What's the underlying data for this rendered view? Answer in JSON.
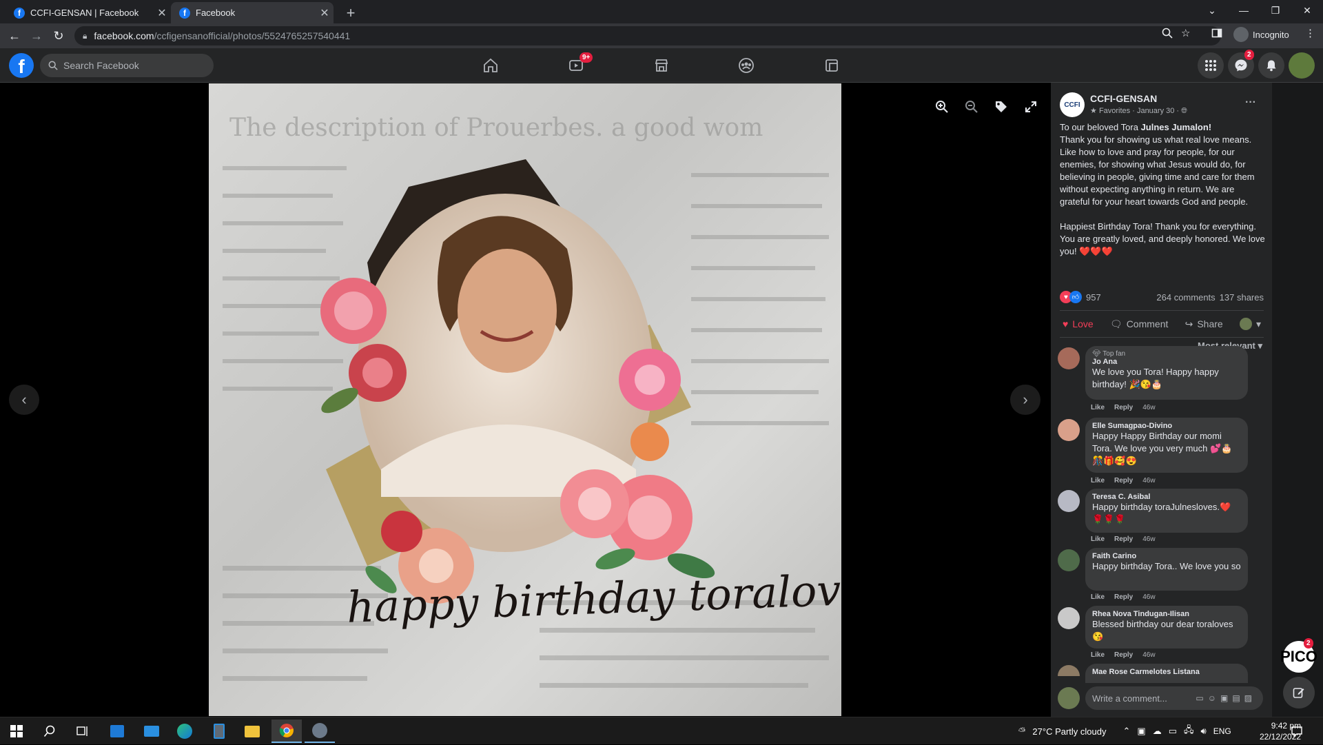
{
  "browser": {
    "tabs": [
      {
        "label": "CCFI-GENSAN | Facebook"
      },
      {
        "label": "Facebook"
      }
    ],
    "url_host": "facebook.com",
    "url_path": "/ccfigensanofficial/photos/5524765257540441",
    "profile_label": "Incognito"
  },
  "fb_header": {
    "search_placeholder": "Search Facebook",
    "watch_badge": "9+",
    "messenger_badge": "2"
  },
  "photo": {
    "overlay_text": "happy birthday toraloves",
    "background_text": "The description of Prouerbes. a good wom"
  },
  "post": {
    "avatar_text": "CCFI",
    "page_name": "CCFI-GENSAN",
    "meta": "Favorites · January 30 ·",
    "caption_lead": "To our beloved Tora ",
    "caption_bold": "Julnes Jumalon!",
    "caption_body": "Thank you for showing us what real love means. Like how to love and pray for people, for our enemies, for showing what Jesus would do, for believing in people, giving time and care for them without expecting anything in return. We are grateful for your heart towards God and people.",
    "caption_end": "Happiest Birthday Tora! Thank you for everything. You are greatly loved, and deeply honored. We love you! ❤️❤️❤️",
    "reaction_count": "957",
    "comments_count": "264 comments",
    "shares_count": "137 shares",
    "actions": {
      "love": "Love",
      "comment": "Comment",
      "share": "Share"
    },
    "sort_label": "Most relevant"
  },
  "comments": [
    {
      "badge": "Top fan",
      "author": "Jo Ana",
      "text": "We love you Tora! Happy happy birthday! 🎉😘🎂",
      "time": "46w"
    },
    {
      "badge": "",
      "author": "Elle Sumagpao-Divino",
      "text": "Happy Happy Birthday our momi Tora. We love you very much 💕🎂 🎊🎁🥰😍",
      "time": "46w"
    },
    {
      "badge": "",
      "author": "Teresa C. Asibal",
      "text": "Happy birthday toraJulnesloves.❤️ 🌹🌹🌹",
      "time": "46w"
    },
    {
      "badge": "",
      "author": "Faith Carino",
      "text": "Happy birthday Tora.. We love you so",
      "time": "46w"
    },
    {
      "badge": "",
      "author": "Rhea Nova Tindugan-Ilisan",
      "text": "Blessed birthday our dear toraloves 😘",
      "time": "46w"
    },
    {
      "badge": "",
      "author": "Mae Rose Carmelotes Listana",
      "text": "",
      "time": ""
    }
  ],
  "comment_actions": {
    "like": "Like",
    "reply": "Reply"
  },
  "write_placeholder": "Write a comment...",
  "floating": {
    "pico_label": "PICO",
    "pico_badge": "2"
  },
  "taskbar": {
    "weather": "27°C  Partly cloudy",
    "lang": "ENG",
    "time": "9:42 pm",
    "date": "22/12/2022"
  },
  "colors": {
    "fb_blue": "#1877f2",
    "love_red": "#f33e58",
    "badge_red": "#e41e3f"
  },
  "icons": [
    "home-icon",
    "watch-icon",
    "marketplace-icon",
    "groups-icon",
    "gaming-icon",
    "menu-grid-icon",
    "messenger-icon",
    "bell-icon",
    "zoom-in-icon",
    "zoom-out-icon",
    "tag-icon",
    "fullscreen-icon"
  ]
}
